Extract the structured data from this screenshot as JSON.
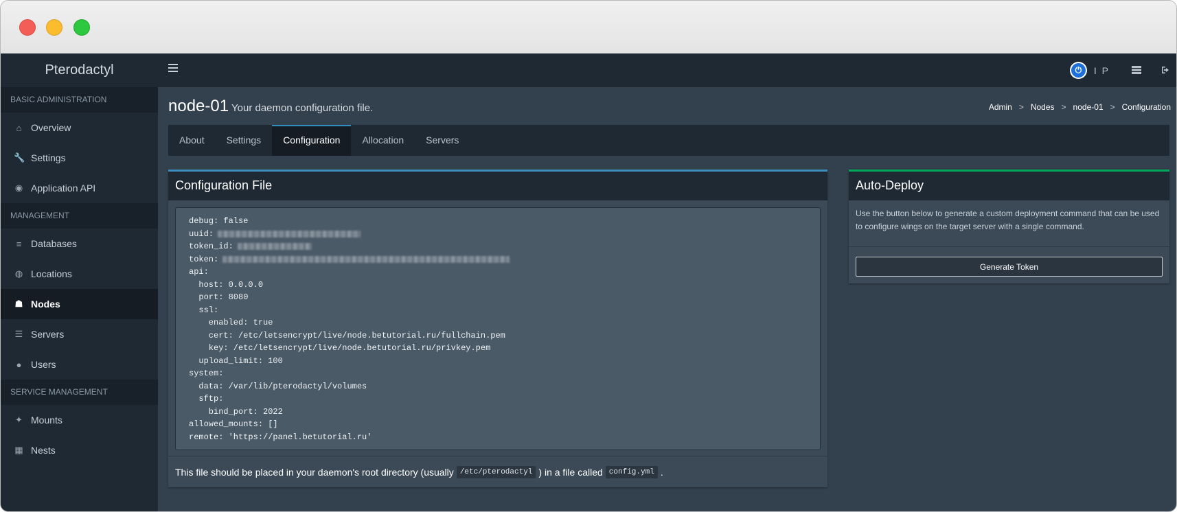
{
  "app": {
    "brand": "Pterodactyl",
    "user_initials": "I P",
    "avatar_glyph": "⏻"
  },
  "sidebar": {
    "sections": [
      {
        "header": "Basic Administration",
        "items": [
          {
            "label": "Overview",
            "icon": "home-icon"
          },
          {
            "label": "Settings",
            "icon": "wrench-icon"
          },
          {
            "label": "Application API",
            "icon": "gamepad-icon"
          }
        ]
      },
      {
        "header": "Management",
        "items": [
          {
            "label": "Databases",
            "icon": "database-icon"
          },
          {
            "label": "Locations",
            "icon": "globe-icon"
          },
          {
            "label": "Nodes",
            "icon": "sitemap-icon",
            "active": true
          },
          {
            "label": "Servers",
            "icon": "server-icon"
          },
          {
            "label": "Users",
            "icon": "users-icon"
          }
        ]
      },
      {
        "header": "Service Management",
        "items": [
          {
            "label": "Mounts",
            "icon": "magic-icon"
          },
          {
            "label": "Nests",
            "icon": "th-large-icon"
          }
        ]
      }
    ]
  },
  "page": {
    "title": "node-01",
    "subtitle": "Your daemon configuration file.",
    "breadcrumb": [
      "Admin",
      "Nodes",
      "node-01",
      "Configuration"
    ]
  },
  "tabs": [
    {
      "label": "About"
    },
    {
      "label": "Settings"
    },
    {
      "label": "Configuration",
      "active": true
    },
    {
      "label": "Allocation"
    },
    {
      "label": "Servers"
    }
  ],
  "config_box": {
    "title": "Configuration File",
    "lines": [
      {
        "text": "debug: false"
      },
      {
        "text": "uuid:",
        "redacted": true
      },
      {
        "text": "token_id:",
        "redacted": true
      },
      {
        "text": "token:",
        "redacted": true
      },
      {
        "text": "api:"
      },
      {
        "text": "  host: 0.0.0.0"
      },
      {
        "text": "  port: 8080"
      },
      {
        "text": "  ssl:"
      },
      {
        "text": "    enabled: true"
      },
      {
        "text": "    cert: /etc/letsencrypt/live/node.betutorial.ru/fullchain.pem"
      },
      {
        "text": "    key: /etc/letsencrypt/live/node.betutorial.ru/privkey.pem"
      },
      {
        "text": "  upload_limit: 100"
      },
      {
        "text": "system:"
      },
      {
        "text": "  data: /var/lib/pterodactyl/volumes"
      },
      {
        "text": "  sftp:"
      },
      {
        "text": "    bind_port: 2022"
      },
      {
        "text": "allowed_mounts: []"
      },
      {
        "text": "remote: 'https://panel.betutorial.ru'"
      }
    ],
    "footer": {
      "text_before": "This file should be placed in your daemon's root directory (usually",
      "path": "/etc/pterodactyl",
      "text_middle": ") in a file called",
      "filename": "config.yml",
      "text_after": "."
    }
  },
  "deploy_box": {
    "title": "Auto-Deploy",
    "description": "Use the button below to generate a custom deployment command that can be used to configure wings on the target server with a single command.",
    "button_label": "Generate Token"
  }
}
